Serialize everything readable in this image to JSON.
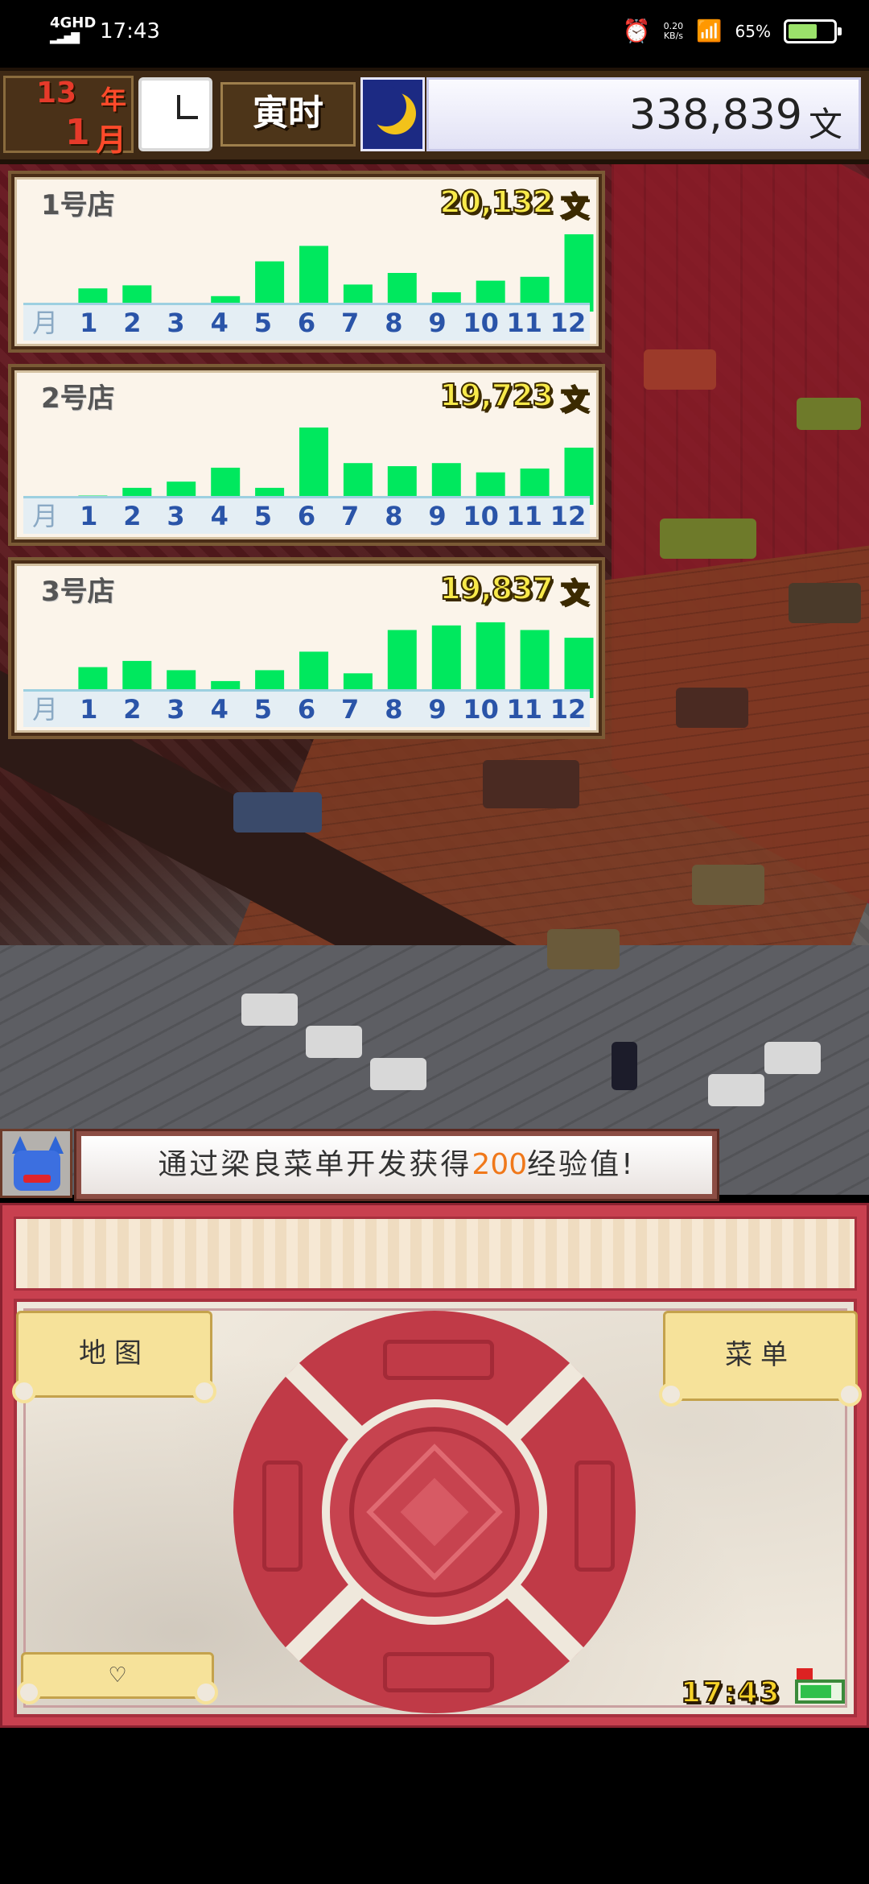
{
  "status_bar": {
    "network": "4GHD",
    "time": "17:43",
    "net_speed_value": "0.20",
    "net_speed_unit": "KB/s",
    "battery": "65%",
    "battery_level": 0.65
  },
  "top_bar": {
    "year_value": "13",
    "year_unit": "年",
    "month_value": "1",
    "month_unit": "月",
    "period": "寅时",
    "money": "338,839",
    "money_unit": "文"
  },
  "shops": [
    {
      "name": "1号店",
      "total": "20,132",
      "unit": "文"
    },
    {
      "name": "2号店",
      "total": "19,723",
      "unit": "文"
    },
    {
      "name": "3号店",
      "total": "19,837",
      "unit": "文"
    }
  ],
  "axis": {
    "label": "月",
    "months": [
      "1",
      "2",
      "3",
      "4",
      "5",
      "6",
      "7",
      "8",
      "9",
      "10",
      "11",
      "12"
    ]
  },
  "chart_data": [
    {
      "type": "bar",
      "title": "1号店",
      "categories": [
        "1",
        "2",
        "3",
        "4",
        "5",
        "6",
        "7",
        "8",
        "9",
        "10",
        "11",
        "12"
      ],
      "values": [
        30,
        34,
        10,
        20,
        65,
        85,
        35,
        50,
        25,
        40,
        45,
        100
      ],
      "colors": {
        "bar": "#00e85e"
      }
    },
    {
      "type": "bar",
      "title": "2号店",
      "categories": [
        "1",
        "2",
        "3",
        "4",
        "5",
        "6",
        "7",
        "8",
        "9",
        "10",
        "11",
        "12"
      ],
      "values": [
        12,
        22,
        30,
        48,
        22,
        100,
        54,
        50,
        54,
        42,
        47,
        74
      ],
      "colors": {
        "bar": "#00e85e"
      }
    },
    {
      "type": "bar",
      "title": "3号店",
      "categories": [
        "1",
        "2",
        "3",
        "4",
        "5",
        "6",
        "7",
        "8",
        "9",
        "10",
        "11",
        "12"
      ],
      "values": [
        40,
        48,
        36,
        22,
        36,
        60,
        32,
        88,
        94,
        98,
        88,
        78
      ],
      "colors": {
        "bar": "#00e85e"
      }
    }
  ],
  "message": {
    "before": "通过梁良菜单开发获得",
    "highlight": "200",
    "after": "经验值!"
  },
  "buttons": {
    "map": "地图",
    "menu": "菜单"
  },
  "game_clock": "17:43"
}
